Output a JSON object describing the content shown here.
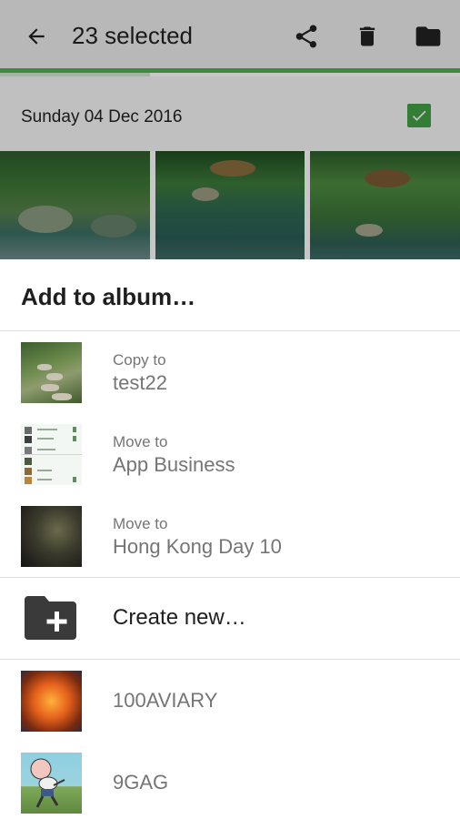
{
  "toolbar": {
    "title": "23 selected",
    "icons": [
      "arrow-back-icon",
      "share-icon",
      "trash-icon",
      "folder-icon"
    ]
  },
  "section": {
    "date": "Sunday 04 Dec 2016",
    "checked": true
  },
  "sheet": {
    "title": "Add to album…",
    "recent": [
      {
        "action": "Copy to",
        "album": "test22"
      },
      {
        "action": "Move to",
        "album": "App Business"
      },
      {
        "action": "Move to",
        "album": "Hong Kong Day 10"
      }
    ],
    "create_label": "Create new…",
    "albums": [
      {
        "name": "100AVIARY"
      },
      {
        "name": "9GAG"
      }
    ]
  },
  "colors": {
    "accent": "#4fb14f",
    "check": "#43a047",
    "secondary_text": "#757575"
  }
}
